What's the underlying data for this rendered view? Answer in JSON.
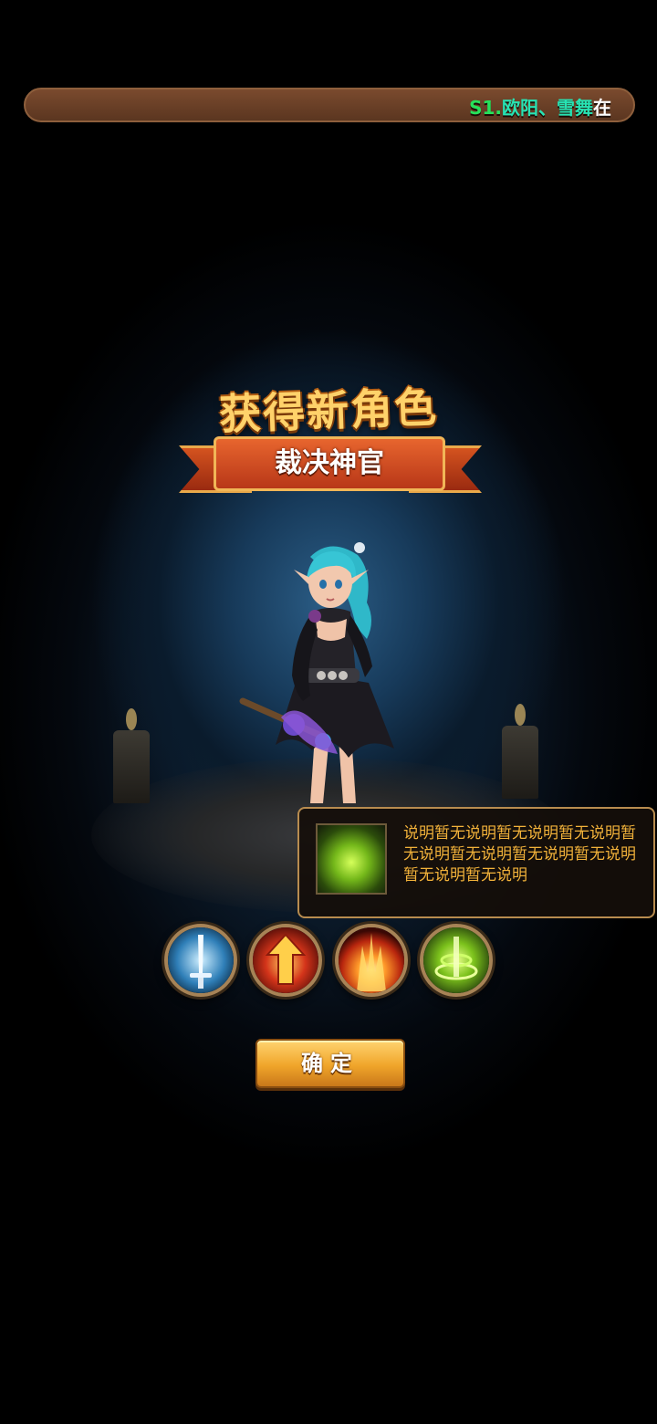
{
  "marquee": {
    "server": "S1.",
    "player": "欧阳、雪舞",
    "rest": "在"
  },
  "banner": {
    "title": "获得新角色",
    "character_name": "裁决神官"
  },
  "tooltip": {
    "description": "说明暂无说明暂无说明暂无说明暂无说明暂无说明暂无说明暂无说明暂无说明暂无说明"
  },
  "skills": [
    {
      "icon": "sword-skill-icon"
    },
    {
      "icon": "rising-arrow-skill-icon"
    },
    {
      "icon": "flame-burst-skill-icon"
    },
    {
      "icon": "green-vortex-skill-icon"
    }
  ],
  "confirm_label": "确定",
  "colors": {
    "marquee_server": "#26e05a",
    "marquee_player": "#27e3b3",
    "tooltip_text": "#f2b23a",
    "button": "#f0a52a"
  }
}
